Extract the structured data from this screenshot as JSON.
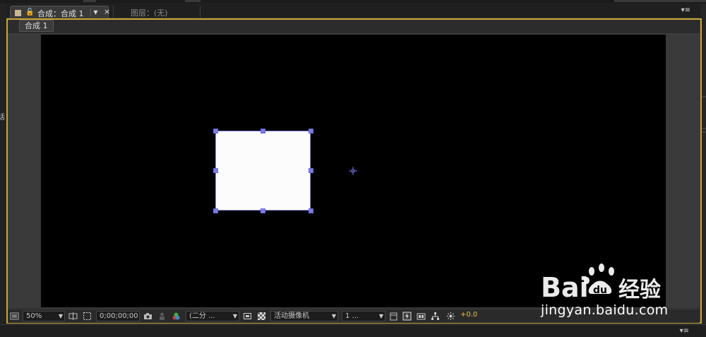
{
  "tabs": {
    "active_label": "合成：合成 1",
    "inactive_label": "图层：(无)",
    "close_glyph": "×",
    "dropdown_glyph": "▼"
  },
  "breadcrumb": {
    "label": "合成 1"
  },
  "panel_menu_glyph": "▾≡",
  "toolbar": {
    "zoom": "50%",
    "timecode": "0;00;00;00",
    "resolution": "(二分 ...",
    "camera": "活动摄像机",
    "views": "1 ...",
    "exposure": "+0.0"
  },
  "colors": {
    "panel_highlight": "#c9a53a",
    "solid_fill": "#fcfcfc",
    "handle": "#7b7be6",
    "exposure_text": "#e7c34b"
  },
  "watermark": {
    "brand": "Bai 经验",
    "url": "jingyan.baidu.com"
  }
}
